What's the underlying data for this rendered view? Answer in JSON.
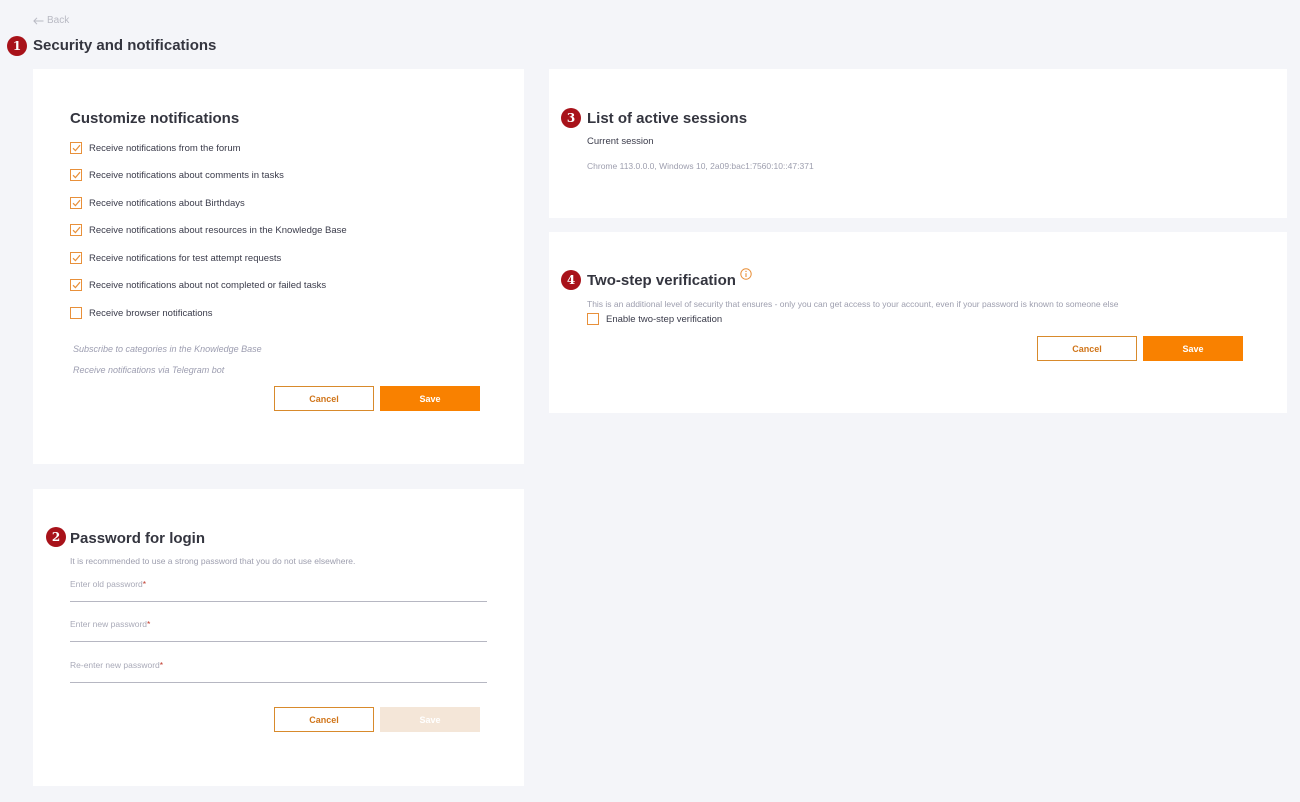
{
  "back": {
    "label": "Back"
  },
  "page_title": "Security and notifications",
  "badges": [
    "1",
    "2",
    "3",
    "4"
  ],
  "notifications": {
    "title": "Customize notifications",
    "options": [
      {
        "label": "Receive notifications from the forum",
        "checked": true
      },
      {
        "label": "Receive notifications about comments in tasks",
        "checked": true
      },
      {
        "label": "Receive notifications about Birthdays",
        "checked": true
      },
      {
        "label": "Receive notifications about resources in the Knowledge Base",
        "checked": true
      },
      {
        "label": "Receive notifications for test attempt requests",
        "checked": true
      },
      {
        "label": "Receive notifications about not completed or failed tasks",
        "checked": true
      },
      {
        "label": "Receive browser notifications",
        "checked": false
      }
    ],
    "links": [
      "Subscribe to categories in the Knowledge Base",
      "Receive notifications via Telegram bot"
    ],
    "cancel_label": "Cancel",
    "save_label": "Save"
  },
  "password": {
    "title": "Password for login",
    "hint": "It is recommended to use a strong password that you do not use elsewhere.",
    "fields": [
      {
        "label": "Enter old password",
        "required_mark": "*"
      },
      {
        "label": "Enter new password",
        "required_mark": "*"
      },
      {
        "label": "Re-enter new password",
        "required_mark": "*"
      }
    ],
    "cancel_label": "Cancel",
    "save_label": "Save",
    "save_disabled": true
  },
  "sessions": {
    "title": "List of active sessions",
    "current_label": "Current session",
    "session_detail": "Chrome 113.0.0.0, Windows 10, 2a09:bac1:7560:10::47:371"
  },
  "two_step": {
    "title": "Two-step verification",
    "description": "This is an additional level of security that ensures - only you can get access to your account, even if your password is known to someone else",
    "checkbox_label": "Enable two-step verification",
    "checked": false,
    "cancel_label": "Cancel",
    "save_label": "Save"
  },
  "colors": {
    "accent": "#f98100",
    "checkbox_border": "#e8903a",
    "badge": "#a8121a",
    "background": "#f4f5f9"
  }
}
